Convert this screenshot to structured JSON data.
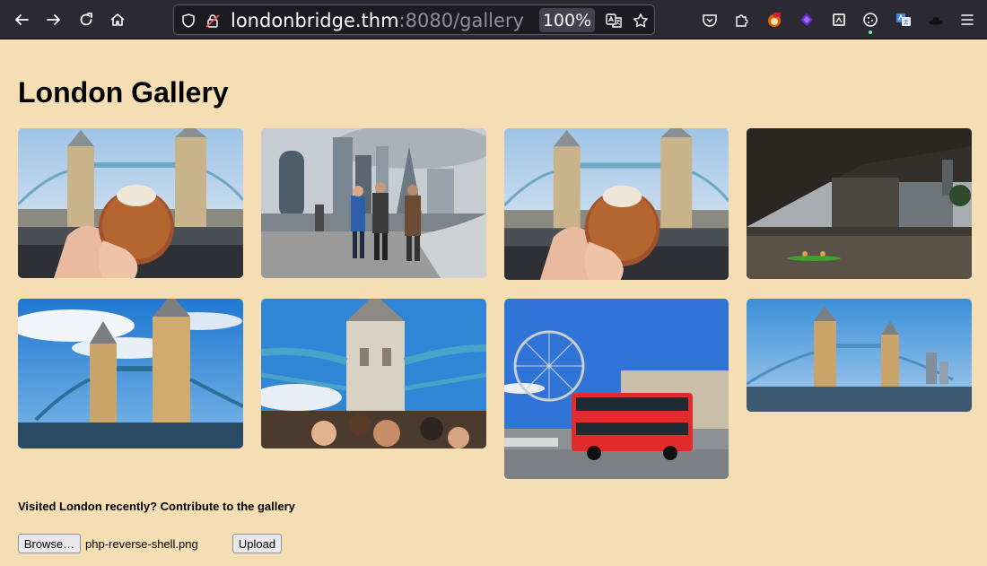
{
  "browser": {
    "url_host": "londonbridge.thm",
    "url_rest": ":8080/gallery",
    "zoom": "100%"
  },
  "page": {
    "title": "London Gallery",
    "contribute_text": "Visited London recently? Contribute to the gallery",
    "browse_label": "Browse…",
    "selected_file": "php-reverse-shell.png",
    "upload_label": "Upload"
  },
  "gallery": [
    {
      "subject": "Tower Bridge with pastry in hand"
    },
    {
      "subject": "City skyline with people walking on riverside"
    },
    {
      "subject": "Tower Bridge with pastry in hand"
    },
    {
      "subject": "Under London Bridge with kayak"
    },
    {
      "subject": "Tower Bridge under blue sky"
    },
    {
      "subject": "Tower Bridge from bus deck"
    },
    {
      "subject": "London Eye and red sightseeing bus"
    },
    {
      "subject": "Tower Bridge with city skyline"
    }
  ],
  "colors": {
    "page_bg": "#f5deb3",
    "toolbar_bg": "#2b2a33"
  }
}
